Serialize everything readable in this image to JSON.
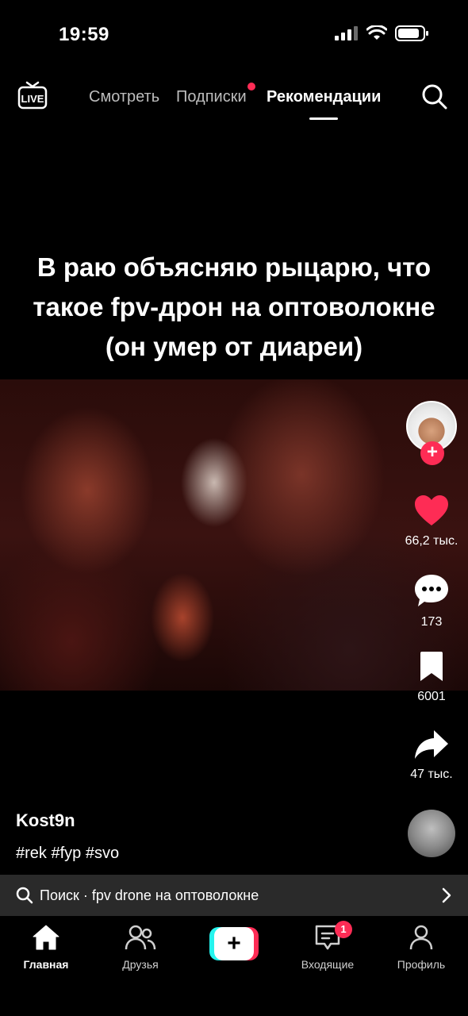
{
  "status_bar": {
    "time": "19:59"
  },
  "top_nav": {
    "live_label": "LIVE",
    "tabs": [
      {
        "label": "Смотреть"
      },
      {
        "label": "Подписки"
      },
      {
        "label": "Рекомендации"
      }
    ]
  },
  "video": {
    "caption_lines": [
      "В раю объясняю рыцарю, что",
      "такое fpv-дрон на оптоволокне",
      "(он умер от диареи)"
    ]
  },
  "actions": {
    "likes": "66,2 тыс.",
    "comments": "173",
    "saves": "6001",
    "shares": "47 тыс."
  },
  "post": {
    "username": "Kost9n",
    "hashtags": "#rek #fyp #svo"
  },
  "search_suggestion": {
    "text": "Поиск · fpv drone на оптоволокне"
  },
  "bottom_nav": {
    "items": [
      {
        "label": "Главная"
      },
      {
        "label": "Друзья"
      },
      {
        "label": "Входящие"
      },
      {
        "label": "Профиль"
      }
    ],
    "create_label": "+",
    "inbox_badge": "1"
  },
  "colors": {
    "accent": "#fe2c55",
    "create_cyan": "#25f4ee",
    "background": "#000000"
  }
}
